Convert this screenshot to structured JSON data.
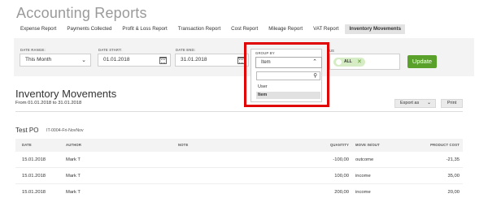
{
  "app": {
    "title": "Accounting Reports"
  },
  "tabs": [
    {
      "label": "Expense Report",
      "active": false
    },
    {
      "label": "Payments Collected",
      "active": false
    },
    {
      "label": "Profit & Loss Report",
      "active": false
    },
    {
      "label": "Transaction Report",
      "active": false
    },
    {
      "label": "Cost Report",
      "active": false
    },
    {
      "label": "Mileage Report",
      "active": false
    },
    {
      "label": "VAT Report",
      "active": false
    },
    {
      "label": "Inventory Movements",
      "active": true
    }
  ],
  "filters": {
    "date_range": {
      "label": "DATE RANGE:",
      "value": "This Month"
    },
    "date_start": {
      "label": "DATE START:",
      "value": "01.01.2018"
    },
    "date_end": {
      "label": "DATE END:",
      "value": "31.01.2018"
    },
    "group_by": {
      "label": "GROUP BY",
      "value": "Item",
      "search_placeholder": "",
      "options": [
        {
          "label": "User",
          "selected": false
        },
        {
          "label": "Item",
          "selected": true
        }
      ]
    },
    "status": {
      "label": "US",
      "pill": "ALL"
    },
    "update_label": "Update"
  },
  "report": {
    "title": "Inventory Movements",
    "subtitle": "From 01.01.2018 to 31.01.2018",
    "export_label": "Export as",
    "print_label": "Print"
  },
  "group": {
    "name": "Test PO",
    "id": "IT-0004-Fri-NovNov"
  },
  "table": {
    "columns": [
      "DATE",
      "AUTHOR",
      "NOTE",
      "QUANTITY",
      "MOVE IN/OUT",
      "PRODUCT COST"
    ],
    "rows": [
      {
        "date": "15.01.2018",
        "author": "Mark T",
        "note": "",
        "quantity": "-100,00",
        "move": "outcome",
        "cost": "-21,35"
      },
      {
        "date": "15.01.2018",
        "author": "Mark T",
        "note": "",
        "quantity": "100,00",
        "move": "income",
        "cost": "35,00"
      },
      {
        "date": "15.01.2018",
        "author": "Mark T",
        "note": "",
        "quantity": "200,00",
        "move": "income",
        "cost": "20,00"
      }
    ]
  },
  "colors": {
    "accent": "#5aa12c",
    "highlight": "#e00000",
    "pill": "#d6ecc4"
  }
}
